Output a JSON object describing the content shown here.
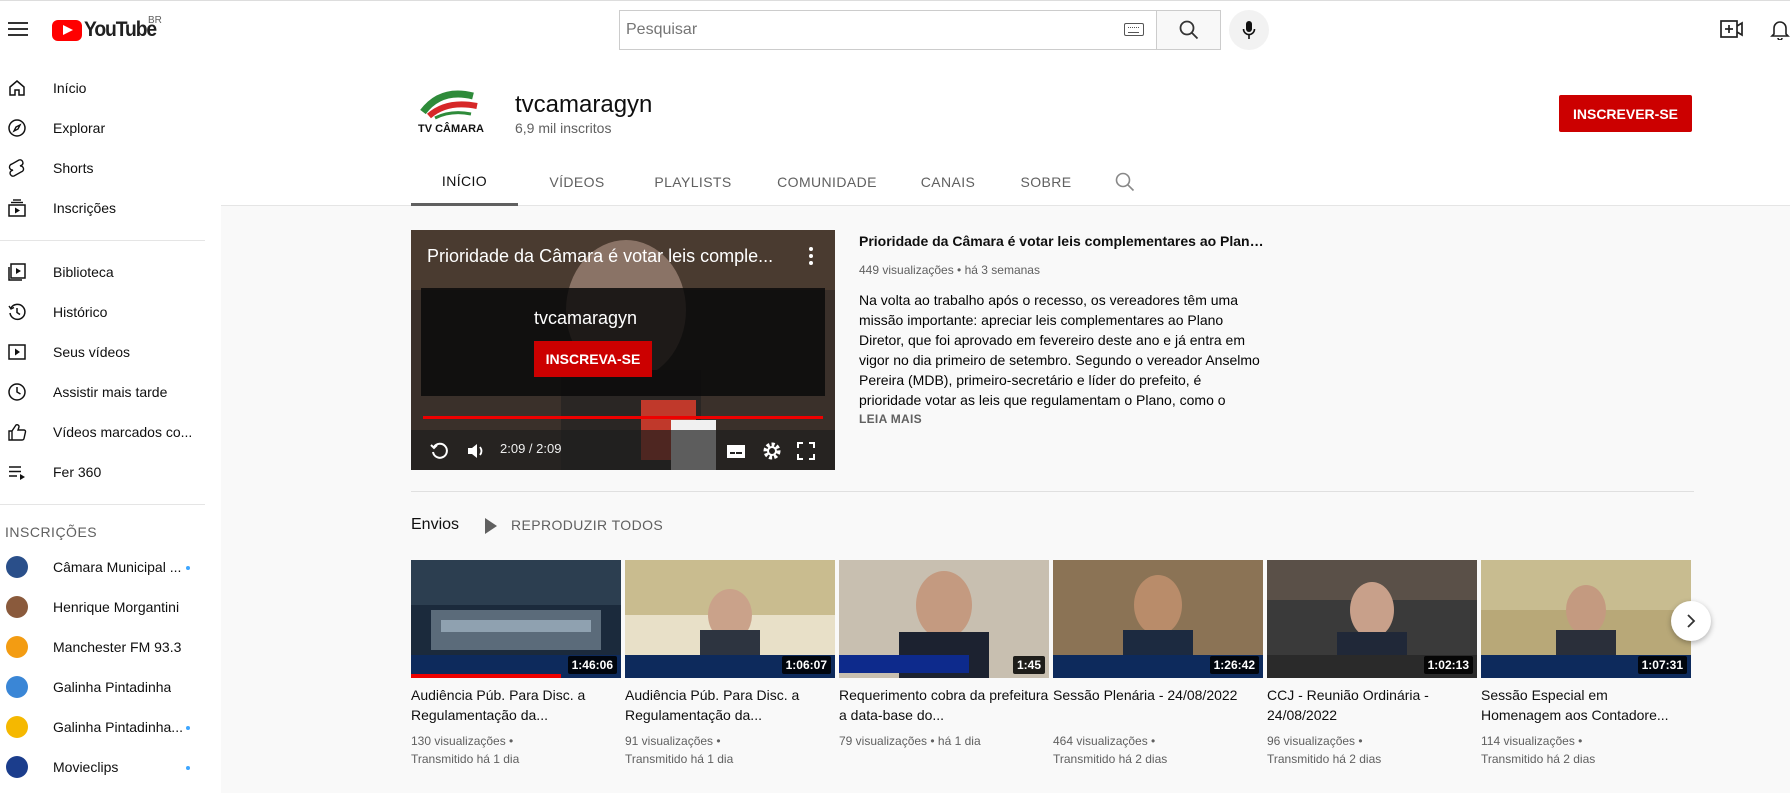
{
  "header": {
    "logo_text": "YouTube",
    "country_code": "BR",
    "search_placeholder": "Pesquisar"
  },
  "sidebar": {
    "main_items": [
      {
        "label": "Início",
        "icon": "home-icon"
      },
      {
        "label": "Explorar",
        "icon": "compass-icon"
      },
      {
        "label": "Shorts",
        "icon": "shorts-icon"
      },
      {
        "label": "Inscrições",
        "icon": "subscriptions-icon"
      }
    ],
    "library_items": [
      {
        "label": "Biblioteca",
        "icon": "library-icon"
      },
      {
        "label": "Histórico",
        "icon": "history-icon"
      },
      {
        "label": "Seus vídeos",
        "icon": "your-videos-icon"
      },
      {
        "label": "Assistir mais tarde",
        "icon": "watch-later-icon"
      },
      {
        "label": "Vídeos marcados co...",
        "icon": "liked-icon"
      },
      {
        "label": "Fer 360",
        "icon": "playlist-icon"
      }
    ],
    "subscriptions_heading": "INSCRIÇÕES",
    "subscriptions": [
      {
        "label": "Câmara Municipal ...",
        "new": true,
        "color": "#2a4f8a"
      },
      {
        "label": "Henrique Morgantini",
        "new": false,
        "color": "#8a5a3c"
      },
      {
        "label": "Manchester FM 93.3",
        "new": false,
        "color": "#f39c12"
      },
      {
        "label": "Galinha Pintadinha",
        "new": false,
        "color": "#3a86d6"
      },
      {
        "label": "Galinha Pintadinha...",
        "new": true,
        "color": "#f5b800"
      },
      {
        "label": "Movieclips",
        "new": true,
        "color": "#1b3d8c"
      }
    ]
  },
  "channel": {
    "name": "tvcamaragyn",
    "subscribers": "6,9 mil inscritos",
    "subscribe_label": "INSCREVER-SE",
    "avatar_text": "TV CÂMARA",
    "tabs": [
      "INÍCIO",
      "VÍDEOS",
      "PLAYLISTS",
      "COMUNIDADE",
      "CANAIS",
      "SOBRE"
    ]
  },
  "featured": {
    "overlay_title": "Prioridade da Câmara é votar leis comple...",
    "card_channel": "tvcamaragyn",
    "card_button": "INSCREVA-SE",
    "time": "2:09 / 2:09",
    "progress_fraction": 1.0,
    "title": "Prioridade da Câmara é votar leis complementares ao Plano D...",
    "meta": "449 visualizações • há 3 semanas",
    "description": "Na volta ao trabalho após o recesso, os vereadores têm uma missão importante: apreciar leis complementares ao Plano Diretor, que foi aprovado em fevereiro deste ano e já entra em vigor no dia primeiro de setembro. Segundo o vereador Anselmo Pereira (MDB), primeiro-secretário e líder do prefeito, é prioridade votar as leis que regulamentam o Plano, como o Código de Posturas e a Lei Ambiental de Goiânia. Anselmo ...",
    "read_more": "LEIA MAIS"
  },
  "shelf": {
    "title": "Envios",
    "play_all": "REPRODUZIR TODOS",
    "videos": [
      {
        "title": "Audiência Púb. Para Disc. a Regulamentação da...",
        "duration": "1:46:06",
        "views": "130 visualizações •",
        "when": "Transmitido há 1 dia",
        "watched": true
      },
      {
        "title": "Audiência Púb. Para Disc. a Regulamentação da...",
        "duration": "1:06:07",
        "views": "91 visualizações •",
        "when": "Transmitido há 1 dia",
        "watched": false
      },
      {
        "title": "Requerimento cobra da prefeitura a data-base do...",
        "duration": "1:45",
        "views": "79 visualizações • há 1 dia",
        "when": "",
        "watched": false
      },
      {
        "title": "Sessão Plenária - 24/08/2022",
        "duration": "1:26:42",
        "views": "464 visualizações •",
        "when": "Transmitido há 2 dias",
        "watched": false
      },
      {
        "title": "CCJ - Reunião Ordinária - 24/08/2022",
        "duration": "1:02:13",
        "views": "96 visualizações •",
        "when": "Transmitido há 2 dias",
        "watched": false
      },
      {
        "title": "Sessão Especial em Homenagem aos Contadore...",
        "duration": "1:07:31",
        "views": "114 visualizações •",
        "when": "Transmitido há 2 dias",
        "watched": false
      }
    ]
  }
}
